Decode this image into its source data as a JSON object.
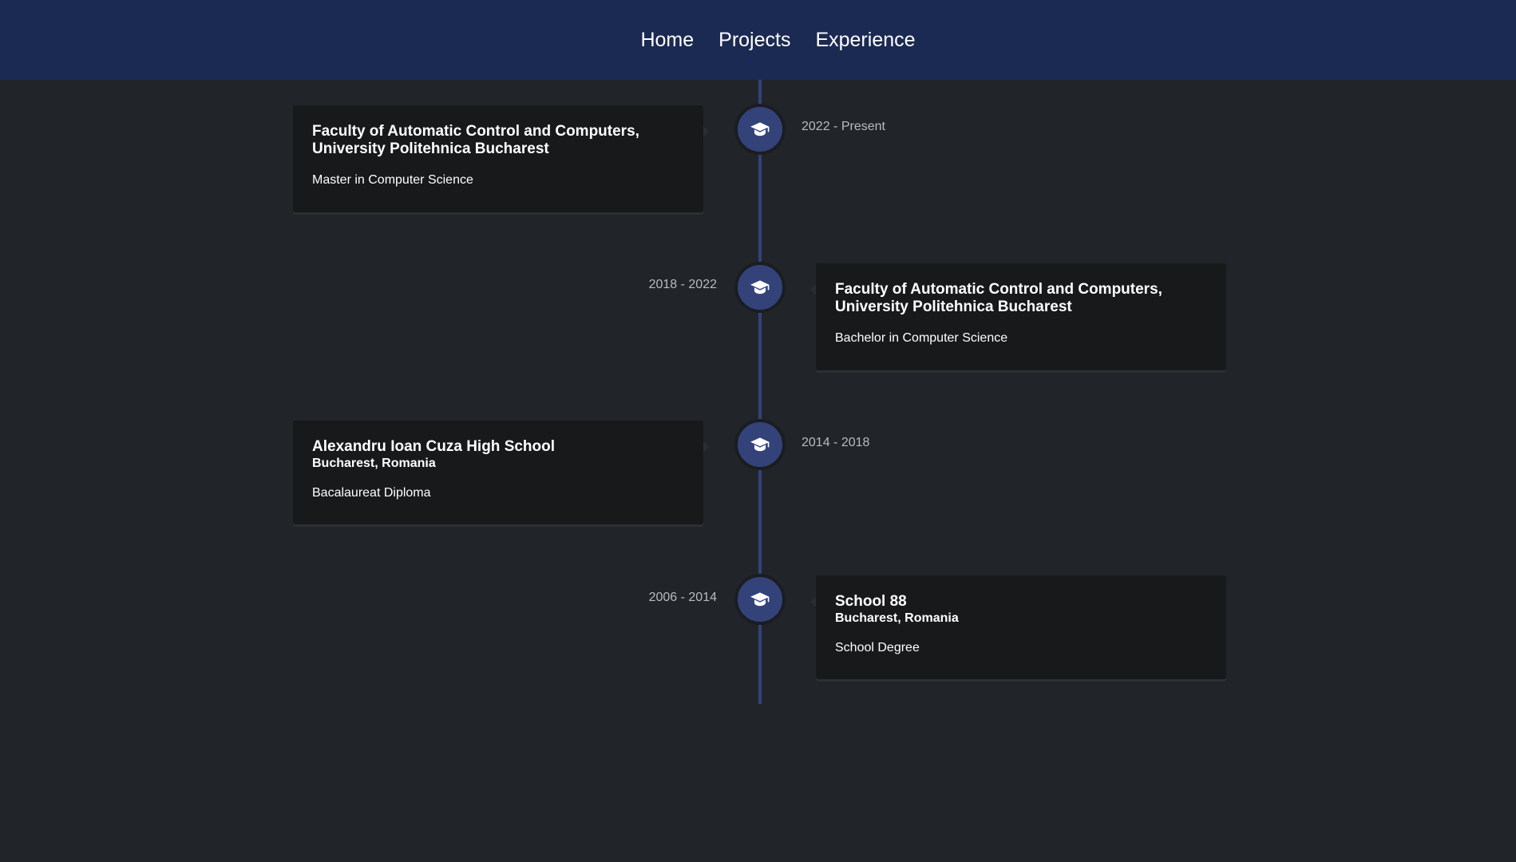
{
  "nav": {
    "items": [
      {
        "label": "Home"
      },
      {
        "label": "Projects"
      },
      {
        "label": "Experience"
      }
    ]
  },
  "timeline": {
    "entries": [
      {
        "date": "2022 - Present",
        "title": "Faculty of Automatic Control and Computers, University Politehnica Bucharest",
        "subtitle": "",
        "text": "Master in Computer Science",
        "icon": "graduation-cap-icon"
      },
      {
        "date": "2018 - 2022",
        "title": "Faculty of Automatic Control and Computers, University Politehnica Bucharest",
        "subtitle": "",
        "text": "Bachelor in Computer Science",
        "icon": "graduation-cap-icon"
      },
      {
        "date": "2014 - 2018",
        "title": "Alexandru Ioan Cuza High School",
        "subtitle": "Bucharest, Romania",
        "text": "Bacalaureat Diploma",
        "icon": "graduation-cap-icon"
      },
      {
        "date": "2006 - 2014",
        "title": "School 88",
        "subtitle": "Bucharest, Romania",
        "text": "School Degree",
        "icon": "graduation-cap-icon"
      }
    ]
  },
  "colors": {
    "navbar": "#1b2a52",
    "background": "#212428",
    "timeline_accent": "#34427a",
    "card": "#18191b"
  }
}
